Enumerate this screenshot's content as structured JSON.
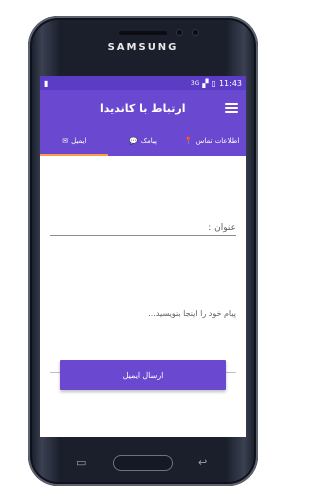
{
  "device": {
    "brand": "SAMSUNG"
  },
  "status_bar": {
    "network": "3G",
    "time": "11:43"
  },
  "app_bar": {
    "title": "ارتباط با کاندیدا"
  },
  "tabs": [
    {
      "label": "اطلاعات تماس",
      "icon": "pin-icon"
    },
    {
      "label": "پیامک",
      "icon": "chat-icon"
    },
    {
      "label": "ایمیل",
      "icon": "email-icon",
      "active": true
    }
  ],
  "form": {
    "subject_label": "عنوان :",
    "message_placeholder": "پیام خود را اینجا بنویسید...",
    "send_button": "ارسال ایمیل"
  },
  "colors": {
    "primary": "#6a49d0",
    "status_bar": "#5b3cc4",
    "tab_indicator": "#ff9a4a"
  }
}
